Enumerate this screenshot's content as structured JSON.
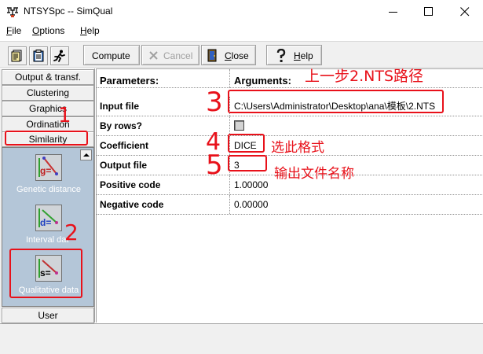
{
  "window": {
    "title": "NTSYSpc  -- SimQual",
    "icon": "app-icon"
  },
  "menu": {
    "file": {
      "accel": "F",
      "rest": "ile"
    },
    "options": {
      "accel": "O",
      "rest": "ptions"
    },
    "help": {
      "accel": "H",
      "rest": "elp"
    }
  },
  "toolbar": {
    "icons": [
      "edit-file-icon",
      "clipboard-icon",
      "run-icon"
    ],
    "compute": "Compute",
    "cancel": "Cancel",
    "close_accel": "C",
    "close_rest": "lose",
    "help_accel": "H",
    "help_rest": "elp"
  },
  "categories": {
    "output": "Output & transf.",
    "clustering": "Clustering",
    "graphics": "Graphics",
    "ordination": "Ordination",
    "similarity": "Similarity",
    "user": "User"
  },
  "modules": {
    "genetic": {
      "label": "Genetic distance",
      "glyph": "g="
    },
    "interval": {
      "label": "Interval dat",
      "glyph": "d="
    },
    "qualitative": {
      "label": "Qualitative data",
      "glyph": "s="
    }
  },
  "grid": {
    "header_param": "Parameters:",
    "header_arg": "Arguments:",
    "rows": [
      {
        "param": "Input file",
        "arg": "C:\\Users\\Administrator\\Desktop\\ana\\模板\\2.NTS"
      },
      {
        "param": "By rows?",
        "arg": ""
      },
      {
        "param": "Coefficient",
        "arg": "DICE"
      },
      {
        "param": "Output file",
        "arg": "3"
      },
      {
        "param": "Positive code",
        "arg": "1.00000"
      },
      {
        "param": "Negative code",
        "arg": "0.00000"
      }
    ]
  },
  "annotations": {
    "n1": "1",
    "n2": "2",
    "n3": "3",
    "n4": "4",
    "n5": "5",
    "note_path": "上一步2.NTS路径",
    "note_format": "选此格式",
    "note_output": "输出文件名称",
    "color": "#e8111a"
  }
}
